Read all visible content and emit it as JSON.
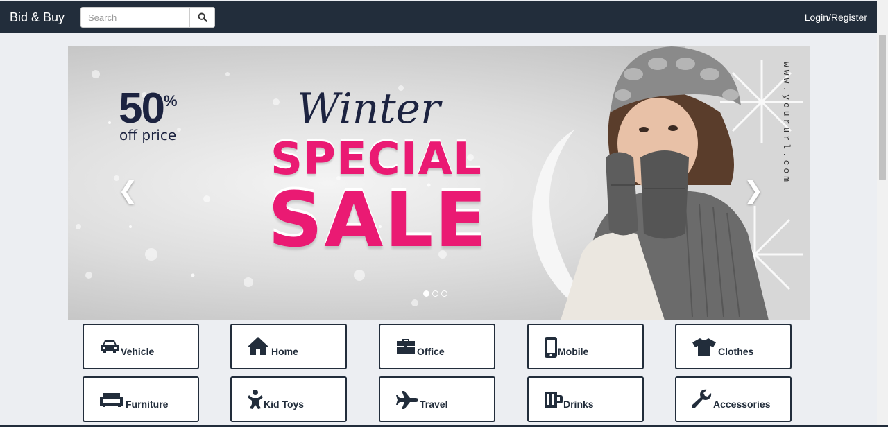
{
  "navbar": {
    "brand": "Bid & Buy",
    "search_placeholder": "Search",
    "search_icon": "search-icon",
    "login_label": "Login/Register"
  },
  "carousel": {
    "discount_number": "50",
    "discount_symbol": "%",
    "discount_text": "off price",
    "headline": "Winter",
    "subheadline": "SPECIAL",
    "headline_big": "SALE",
    "url_text": "www.yoururl.com",
    "prev_icon": "chevron-left-icon",
    "next_icon": "chevron-right-icon",
    "slide_count": 3,
    "active_slide": 1
  },
  "categories": [
    {
      "label": "Vehicle",
      "icon": "car-icon"
    },
    {
      "label": "Home",
      "icon": "house-icon"
    },
    {
      "label": "Office",
      "icon": "briefcase-icon"
    },
    {
      "label": "Mobile",
      "icon": "mobile-phone-icon"
    },
    {
      "label": "Clothes",
      "icon": "tshirt-icon"
    },
    {
      "label": "Furniture",
      "icon": "sofa-icon"
    },
    {
      "label": "Kid Toys",
      "icon": "child-icon"
    },
    {
      "label": "Travel",
      "icon": "airplane-icon"
    },
    {
      "label": "Drinks",
      "icon": "mug-icon"
    },
    {
      "label": "Accessories",
      "icon": "wrench-icon"
    }
  ],
  "colors": {
    "navbar_bg": "#222d3b",
    "sale_pink": "#ea1a73",
    "page_bg": "#eceef2"
  }
}
